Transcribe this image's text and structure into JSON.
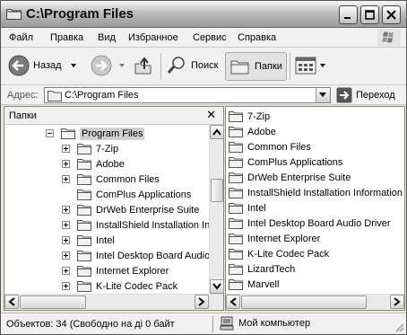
{
  "window": {
    "title": "C:\\Program Files"
  },
  "menu": {
    "items": [
      "Файл",
      "Правка",
      "Вид",
      "Избранное",
      "Сервис",
      "Справка"
    ]
  },
  "toolbar": {
    "back_label": "Назад",
    "search_label": "Поиск",
    "folders_label": "Папки"
  },
  "address": {
    "label": "Адрес:",
    "value": "C:\\Program Files",
    "go_label": "Переход"
  },
  "left_pane": {
    "title": "Папки",
    "close_glyph": "✕",
    "tree": [
      {
        "label": "Program Files",
        "expander": "minus",
        "selected": true
      },
      {
        "label": "7-Zip",
        "expander": "plus"
      },
      {
        "label": "Adobe",
        "expander": "plus"
      },
      {
        "label": "Common Files",
        "expander": "plus"
      },
      {
        "label": "ComPlus Applications",
        "expander": "none"
      },
      {
        "label": "DrWeb Enterprise Suite",
        "expander": "plus"
      },
      {
        "label": "InstallShield Installation Inf",
        "expander": "plus"
      },
      {
        "label": "Intel",
        "expander": "plus"
      },
      {
        "label": "Intel Desktop Board Audio",
        "expander": "plus"
      },
      {
        "label": "Internet Explorer",
        "expander": "plus"
      },
      {
        "label": "K-Lite Codec Pack",
        "expander": "plus"
      }
    ]
  },
  "right_pane": {
    "files": [
      "7-Zip",
      "Adobe",
      "Common Files",
      "ComPlus Applications",
      "DrWeb Enterprise Suite",
      "InstallShield Installation Information",
      "Intel",
      "Intel Desktop Board Audio Driver",
      "Internet Explorer",
      "K-Lite Codec Pack",
      "LizardTech",
      "Marvell"
    ]
  },
  "status": {
    "objects": "Объектов: 34 (Свободно на ді 0 байт",
    "location": "Мой компьютер"
  }
}
